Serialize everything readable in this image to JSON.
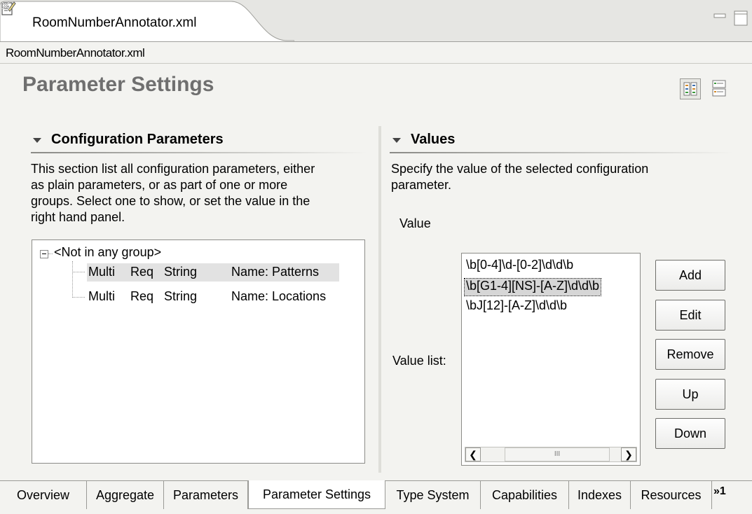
{
  "editor": {
    "tab_title": "RoomNumberAnnotator.xml",
    "breadcrumb": "RoomNumberAnnotator.xml"
  },
  "page": {
    "title": "Parameter Settings"
  },
  "config_section": {
    "title": "Configuration Parameters",
    "desc_lines": [
      "This section list all configuration parameters, either",
      "as plain parameters, or as part of one or more",
      "groups.  Select one to show, or set the value in the",
      "right hand panel."
    ],
    "tree": {
      "group_label": "<Not in any group>",
      "rows": [
        {
          "multi": "Multi",
          "req": "Req",
          "type": "String",
          "name": "Name: Patterns"
        },
        {
          "multi": "Multi",
          "req": "Req",
          "type": "String",
          "name": "Name: Locations"
        }
      ]
    }
  },
  "values_section": {
    "title": "Values",
    "desc_lines": [
      "Specify the value of the selected configuration",
      "parameter."
    ],
    "value_label": "Value",
    "value_list_label": "Value list:",
    "items": [
      "\\b[0-4]\\d-[0-2]\\d\\d\\b",
      "\\b[G1-4][NS]-[A-Z]\\d\\d\\b",
      "\\bJ[12]-[A-Z]\\d\\d\\b"
    ],
    "scroll_thumb_grip": "III",
    "buttons": {
      "add": "Add",
      "edit": "Edit",
      "remove": "Remove",
      "up": "Up",
      "down": "Down"
    }
  },
  "bottom_tabs": [
    "Overview",
    "Aggregate",
    "Parameters",
    "Parameter Settings",
    "Type System",
    "Capabilities",
    "Indexes",
    "Resources"
  ],
  "more_tabs_label": "»1",
  "icons": {
    "file": "xml-file-icon",
    "close": "close-icon",
    "minimize": "minimize-icon",
    "maximize": "maximize-icon",
    "layout1": "horizontal-layout-icon",
    "layout2": "vertical-layout-icon"
  }
}
